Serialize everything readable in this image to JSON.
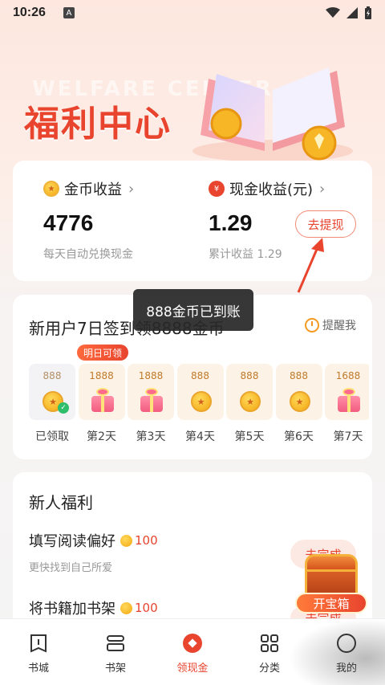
{
  "status_bar": {
    "time": "10:26",
    "badge": "A"
  },
  "hero": {
    "title": "福利中心",
    "bg_text": "WELFARE CENTER"
  },
  "earnings": {
    "coin": {
      "label": "金币收益",
      "value": "4776",
      "sub": "每天自动兑换现金"
    },
    "cash": {
      "label": "现金收益(元)",
      "value": "1.29",
      "sub": "累计收益 1.29"
    },
    "withdraw_label": "去提现"
  },
  "signin": {
    "title": "新用户7日签到领8888金币",
    "remind_label": "提醒我",
    "tomorrow_badge": "明日可领",
    "days": [
      {
        "amount": "888",
        "label": "已领取",
        "kind": "coin",
        "claimed": true
      },
      {
        "amount": "1888",
        "label": "第2天",
        "kind": "gift",
        "claimed": false
      },
      {
        "amount": "1888",
        "label": "第3天",
        "kind": "gift",
        "claimed": false
      },
      {
        "amount": "888",
        "label": "第4天",
        "kind": "coin",
        "claimed": false
      },
      {
        "amount": "888",
        "label": "第5天",
        "kind": "coin",
        "claimed": false
      },
      {
        "amount": "888",
        "label": "第6天",
        "kind": "coin",
        "claimed": false
      },
      {
        "amount": "1688",
        "label": "第7天",
        "kind": "gift",
        "claimed": false
      }
    ]
  },
  "toast": "888金币已到账",
  "newbie": {
    "title": "新人福利",
    "tasks": [
      {
        "name": "填写阅读偏好",
        "reward": "100",
        "sub": "更快找到自己所爱",
        "button": "去完成"
      },
      {
        "name": "将书籍加书架",
        "reward": "100",
        "sub": "",
        "button": "去完成"
      }
    ]
  },
  "treasure": {
    "label": "开宝箱"
  },
  "tabbar": {
    "items": [
      {
        "label": "书城",
        "icon": "book-icon"
      },
      {
        "label": "书架",
        "icon": "shelf-icon"
      },
      {
        "label": "领现金",
        "icon": "cash-reward-icon"
      },
      {
        "label": "分类",
        "icon": "grid-icon"
      },
      {
        "label": "我的",
        "icon": "profile-icon"
      }
    ],
    "active_index": 2
  },
  "colors": {
    "accent": "#e8442e",
    "coin": "#f3a712"
  }
}
